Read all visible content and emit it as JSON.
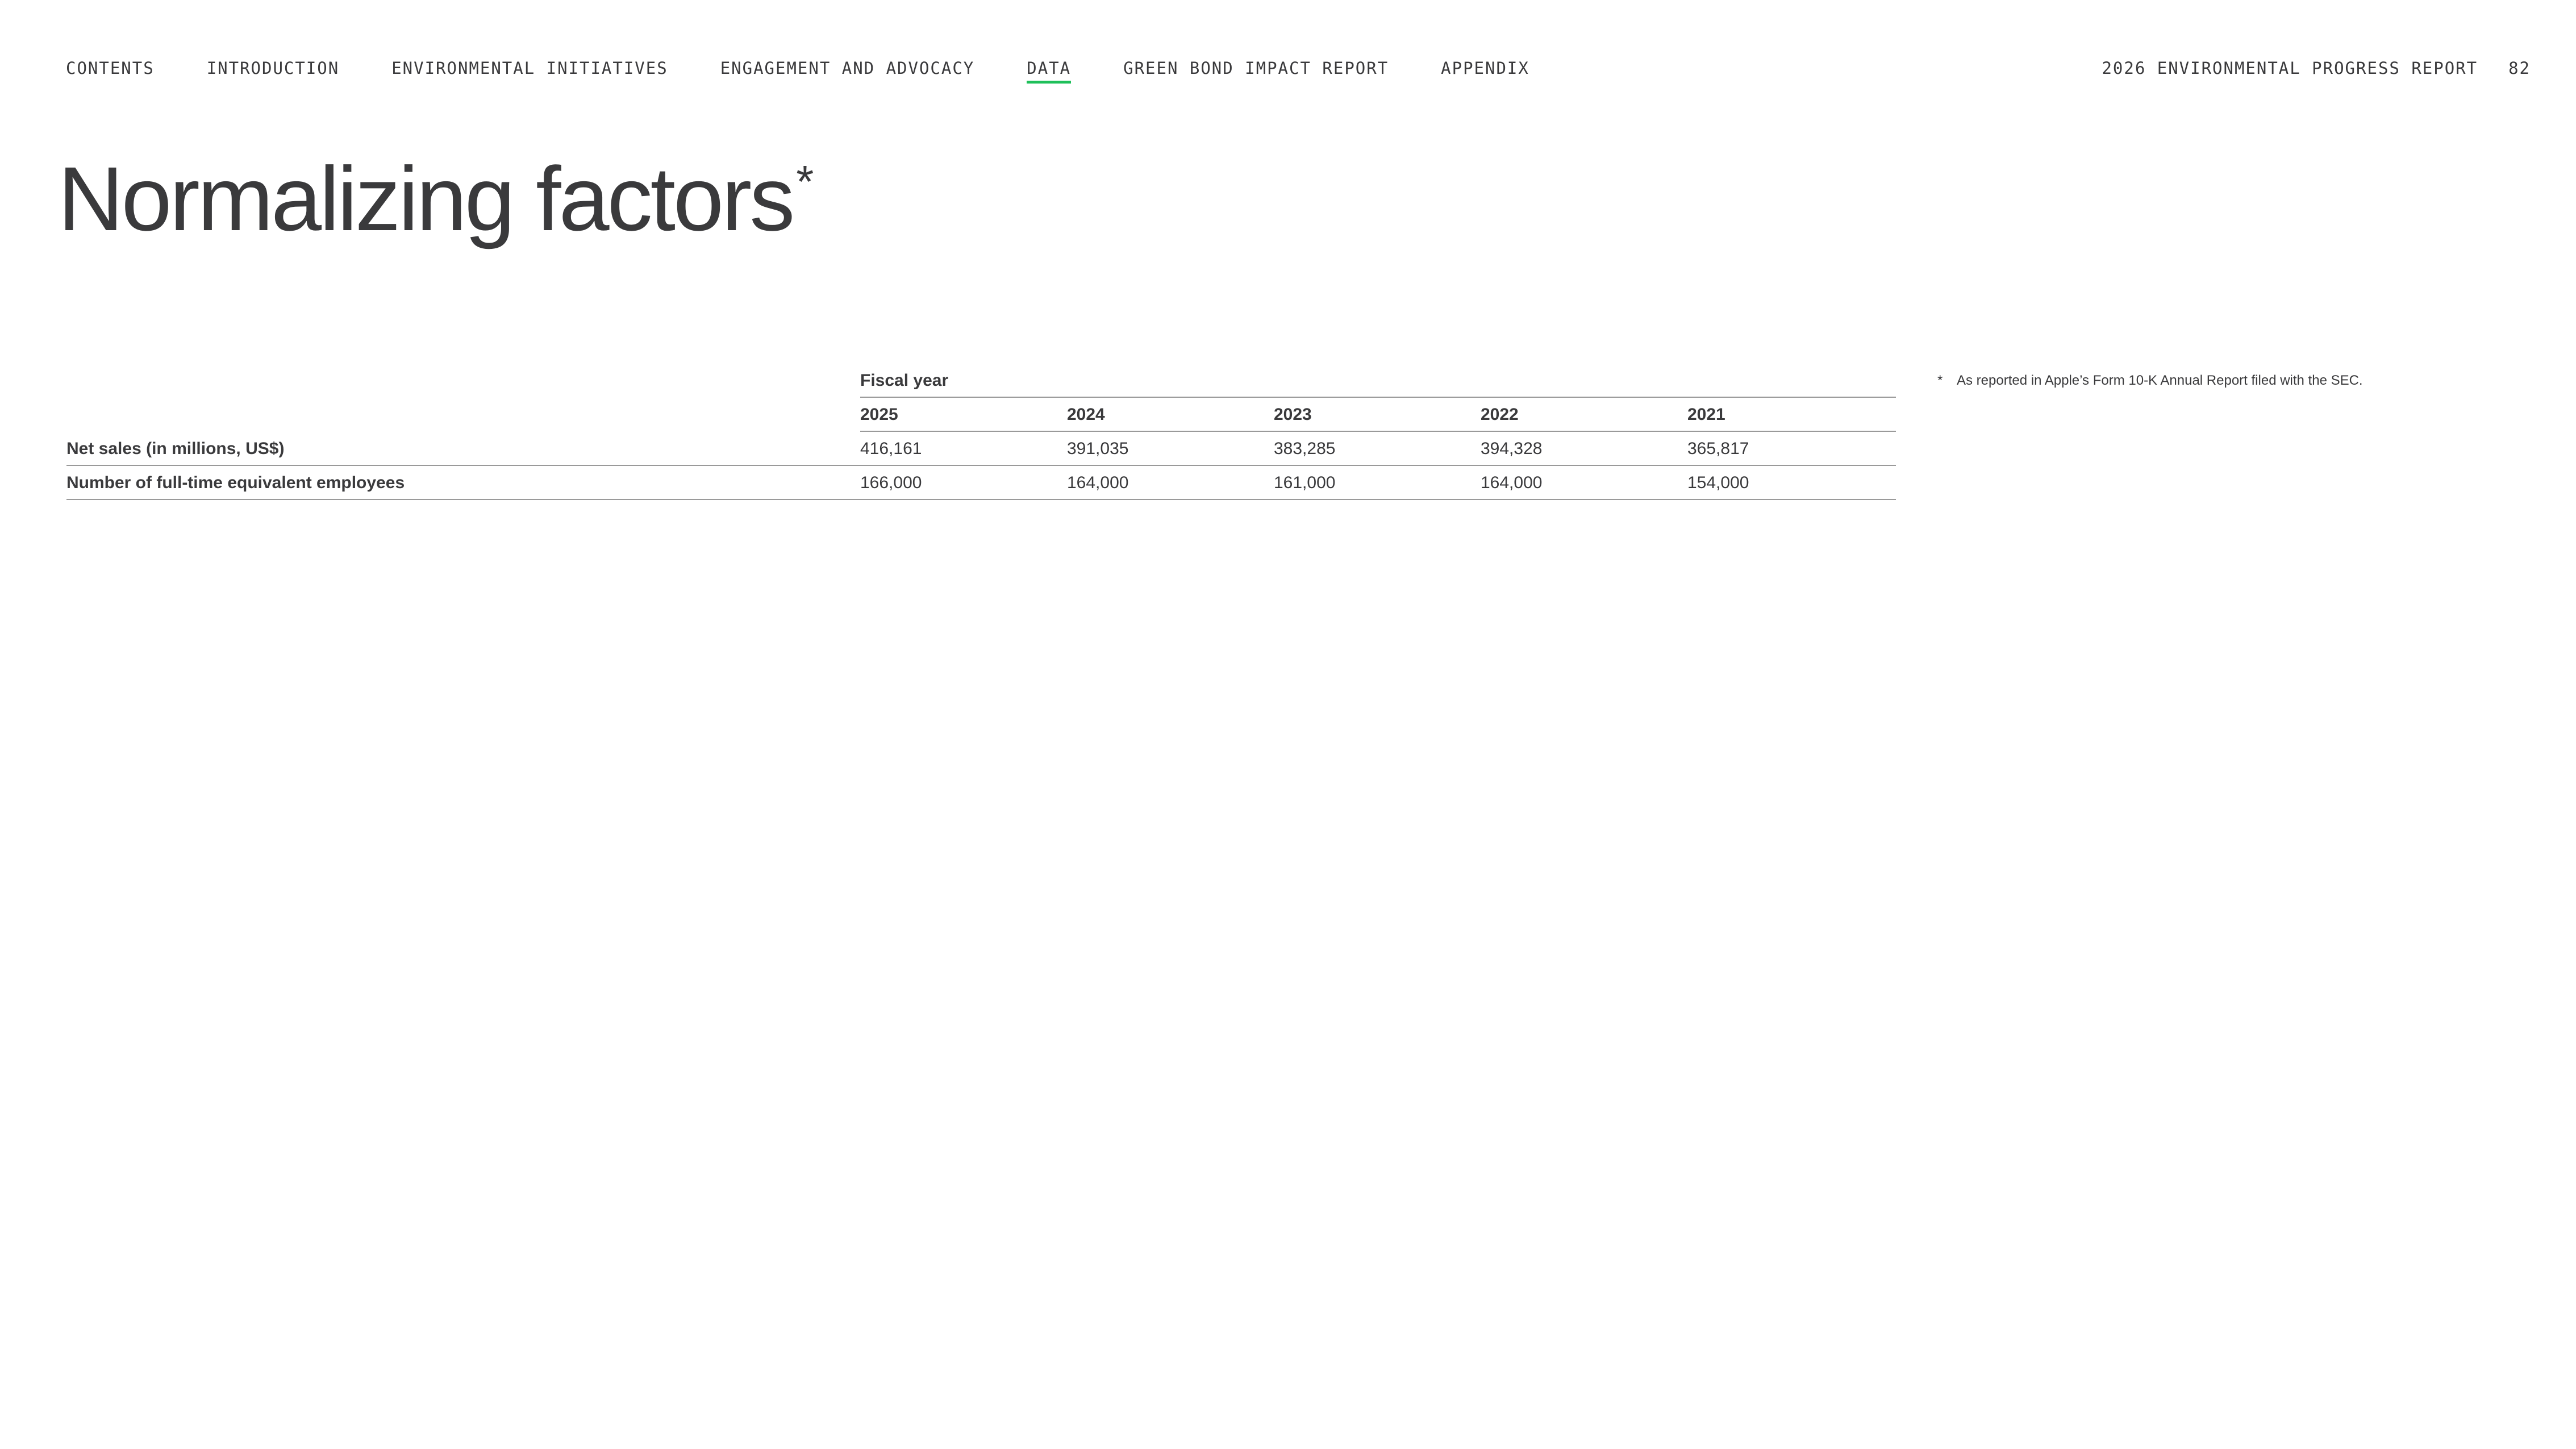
{
  "nav": {
    "items": [
      {
        "label": "CONTENTS",
        "active": false
      },
      {
        "label": "INTRODUCTION",
        "active": false
      },
      {
        "label": "ENVIRONMENTAL INITIATIVES",
        "active": false
      },
      {
        "label": "ENGAGEMENT AND ADVOCACY",
        "active": false
      },
      {
        "label": "DATA",
        "active": true
      },
      {
        "label": "GREEN BOND IMPACT REPORT",
        "active": false
      },
      {
        "label": "APPENDIX",
        "active": false
      }
    ],
    "active_underline_color": "#1fc05a"
  },
  "report": {
    "title": "2026 ENVIRONMENTAL PROGRESS REPORT",
    "page_number": "82"
  },
  "page": {
    "title": "Normalizing factors",
    "title_mark": "*"
  },
  "table": {
    "group_header": "Fiscal year",
    "years": [
      "2025",
      "2024",
      "2023",
      "2022",
      "2021"
    ],
    "rows": [
      {
        "label": "Net sales (in millions, US$)",
        "values": [
          "416,161",
          "391,035",
          "383,285",
          "394,328",
          "365,817"
        ]
      },
      {
        "label": "Number of full-time equivalent employees",
        "values": [
          "166,000",
          "164,000",
          "161,000",
          "164,000",
          "154,000"
        ]
      }
    ]
  },
  "footnote": {
    "mark": "*",
    "text": "As reported in Apple’s Form 10-K Annual Report filed with the SEC."
  }
}
